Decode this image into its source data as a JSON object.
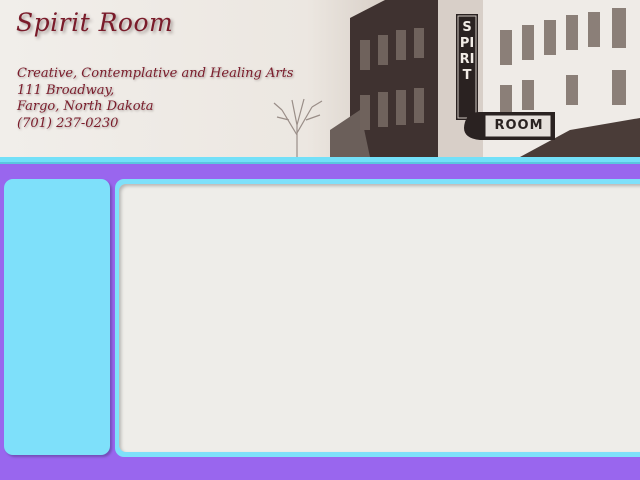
{
  "header": {
    "title": "Spirit Room",
    "tagline": "Creative, Contemplative and Healing Arts",
    "address_line1": "111 Broadway,",
    "address_line2": "Fargo, North Dakota",
    "phone": "(701) 237-0230",
    "sign_vertical": "SPIRIT",
    "sign_horizontal": "ROOM"
  },
  "colors": {
    "page_background": "#9966ee",
    "panel_cyan": "#7ee0fa",
    "content_background": "#eeede9",
    "title_maroon": "#7a1b2a"
  }
}
